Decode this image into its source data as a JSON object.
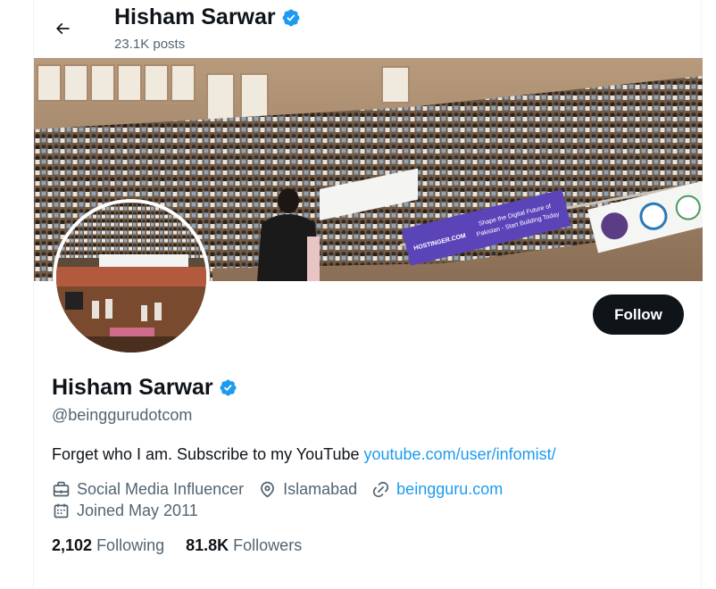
{
  "header": {
    "name": "Hisham Sarwar",
    "posts": "23.1K posts"
  },
  "banner": {
    "sign_text_1": "Shape the Digital Future of",
    "sign_text_2": "Pakistan - Start Building Today",
    "sign_brand": "HOSTINGER.COM"
  },
  "profile": {
    "name": "Hisham Sarwar",
    "handle": "@beinggurudotcom",
    "bio_text": "Forget who I am. Subscribe to my YouTube ",
    "bio_link": "youtube.com/user/infomist/",
    "category": "Social Media Influencer",
    "location": "Islamabad",
    "website": "beingguru.com",
    "joined": "Joined May 2011"
  },
  "stats": {
    "following_count": "2,102",
    "following_label": "Following",
    "followers_count": "81.8K",
    "followers_label": "Followers"
  },
  "actions": {
    "follow_label": "Follow"
  },
  "icons": {
    "back": "arrow-left-icon",
    "verified": "verified-badge-icon",
    "category": "briefcase-icon",
    "location": "location-pin-icon",
    "website": "link-icon",
    "joined": "calendar-icon"
  },
  "colors": {
    "accent": "#1d9bf0",
    "text_primary": "#0f1419",
    "text_secondary": "#536471",
    "button_bg": "#0f1419"
  }
}
